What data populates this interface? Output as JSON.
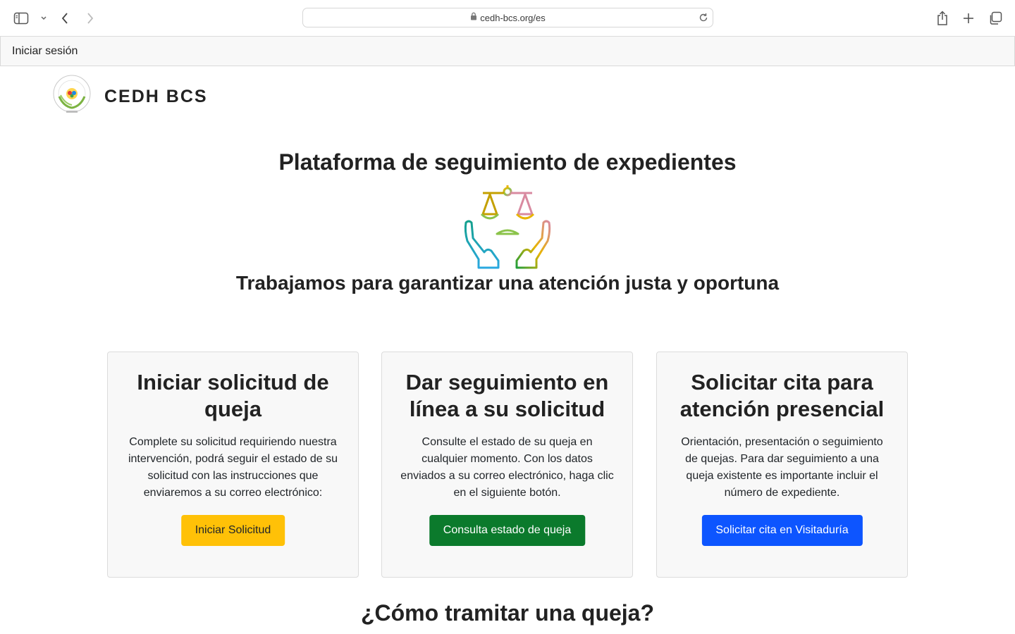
{
  "browser": {
    "url": "cedh-bcs.org/es",
    "icons": [
      "sidebar-icon",
      "chevron-down-icon",
      "back-icon",
      "forward-icon",
      "lock-icon",
      "reload-icon",
      "share-icon",
      "new-tab-icon",
      "tabs-overview-icon"
    ]
  },
  "nav": {
    "login": "Iniciar sesión"
  },
  "brand": {
    "name": "CEDH BCS"
  },
  "hero": {
    "title": "Plataforma de seguimiento de expedientes",
    "subtitle": "Trabajamos para garantizar una atención justa y oportuna"
  },
  "cards": [
    {
      "title": "Iniciar solicitud de queja",
      "text": "Complete su solicitud requiriendo nuestra intervención, podrá seguir el estado de su solicitud con las instrucciones que enviaremos a su correo electrónico:",
      "button": "Iniciar Solicitud",
      "color": "#ffc107"
    },
    {
      "title": "Dar seguimiento en línea a su solicitud",
      "text": "Consulte el estado de su queja en cualquier momento. Con los datos enviados a su correo electrónico, haga clic en el siguiente botón.",
      "button": "Consulta estado de queja",
      "color": "#0b7a2c"
    },
    {
      "title": "Solicitar cita para atención presencial",
      "text": "Orientación, presentación o seguimiento de quejas. Para dar seguimiento a una queja existente es importante incluir el número de expediente.",
      "button": "Solicitar cita en Visitaduría",
      "color": "#0d55ff"
    }
  ],
  "howto": {
    "title": "¿Cómo tramitar una queja?"
  }
}
